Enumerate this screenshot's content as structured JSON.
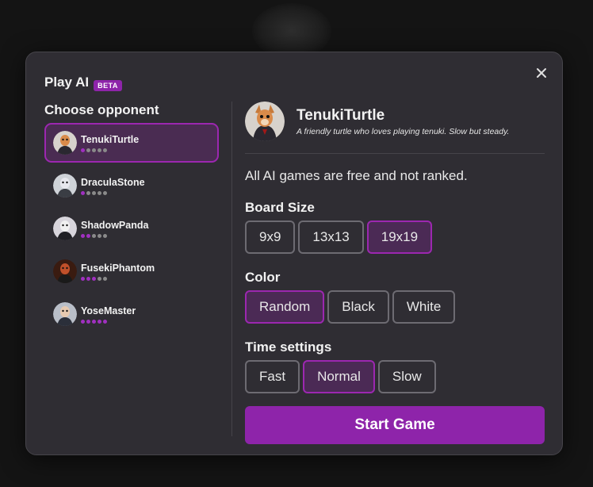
{
  "header": {
    "title": "Play AI",
    "badge": "BETA"
  },
  "opponents_heading": "Choose opponent",
  "opponents": [
    {
      "name": "TenukiTurtle",
      "difficulty": 1,
      "max": 5,
      "selected": true
    },
    {
      "name": "DraculaStone",
      "difficulty": 1,
      "max": 5,
      "selected": false
    },
    {
      "name": "ShadowPanda",
      "difficulty": 2,
      "max": 5,
      "selected": false
    },
    {
      "name": "FusekiPhantom",
      "difficulty": 3,
      "max": 5,
      "selected": false
    },
    {
      "name": "YoseMaster",
      "difficulty": 5,
      "max": 5,
      "selected": false
    }
  ],
  "profile": {
    "name": "TenukiTurtle",
    "description": "A friendly turtle who loves playing tenuki. Slow but steady."
  },
  "note": "All AI games are free and not ranked.",
  "board_size": {
    "label": "Board Size",
    "options": [
      "9x9",
      "13x13",
      "19x19"
    ],
    "selected": "19x19"
  },
  "color": {
    "label": "Color",
    "options": [
      "Random",
      "Black",
      "White"
    ],
    "selected": "Random"
  },
  "time": {
    "label": "Time settings",
    "options": [
      "Fast",
      "Normal",
      "Slow"
    ],
    "selected": "Normal"
  },
  "start_label": "Start Game",
  "colors": {
    "accent": "#8e24aa",
    "panel": "#2f2d33",
    "background": "#141414"
  },
  "icons": {
    "close": "close-icon"
  }
}
